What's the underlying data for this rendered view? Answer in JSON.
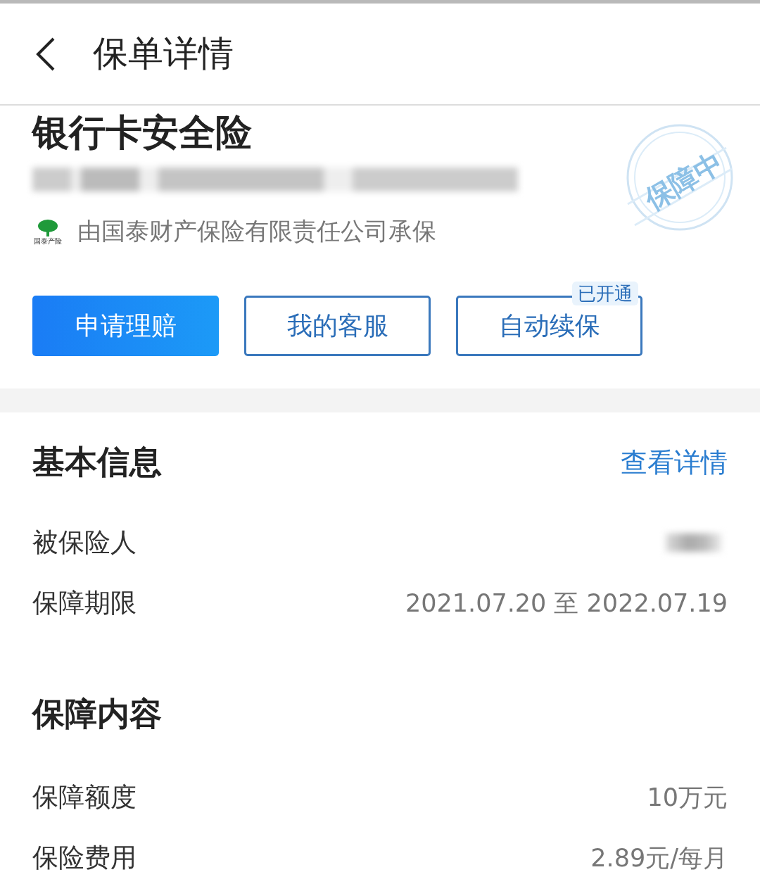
{
  "header": {
    "title": "保单详情"
  },
  "policy": {
    "name": "银行卡安全险",
    "number_redacted": true,
    "insurer_logo_caption": "国泰产险",
    "insurer": "由国泰财产保险有限责任公司承保",
    "stamp": "保障中"
  },
  "actions": [
    {
      "label": "申请理赔",
      "kind": "primary"
    },
    {
      "label": "我的客服",
      "kind": "outline"
    },
    {
      "label": "自动续保",
      "kind": "outline",
      "badge": "已开通"
    }
  ],
  "basic_info": {
    "title": "基本信息",
    "link": "查看详情",
    "rows": [
      {
        "label": "被保险人",
        "value_redacted": true
      },
      {
        "label": "保障期限",
        "value": "2021.07.20 至 2022.07.19"
      }
    ]
  },
  "coverage": {
    "title": "保障内容",
    "rows": [
      {
        "label": "保障额度",
        "value": "10万元"
      },
      {
        "label": "保险费用",
        "value": "2.89元/每月"
      }
    ]
  }
}
